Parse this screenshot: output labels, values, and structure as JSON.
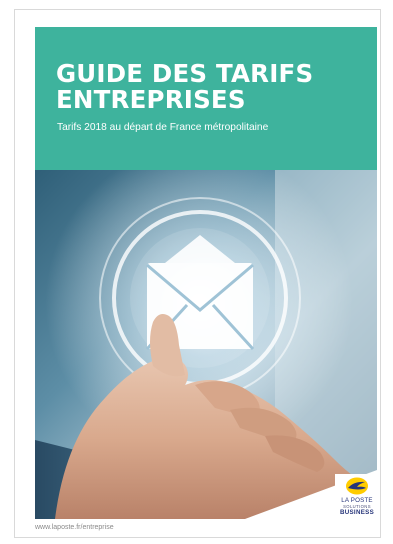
{
  "cover": {
    "title_line1": "GUIDE DES TARIFS",
    "title_line2": "ENTREPRISES",
    "subtitle": "Tarifs 2018 au départ de France métropolitaine"
  },
  "brand": {
    "name_line1": "LA POSTE",
    "name_line2": "SOLUTIONS",
    "name_line3": "BUSINESS"
  },
  "footer": {
    "url": "www.laposte.fr/entreprise"
  },
  "colors": {
    "banner": "#3eb39d",
    "brand_blue": "#27357a",
    "brand_yellow": "#ffcc00"
  },
  "image": {
    "icon": "envelope-icon"
  }
}
